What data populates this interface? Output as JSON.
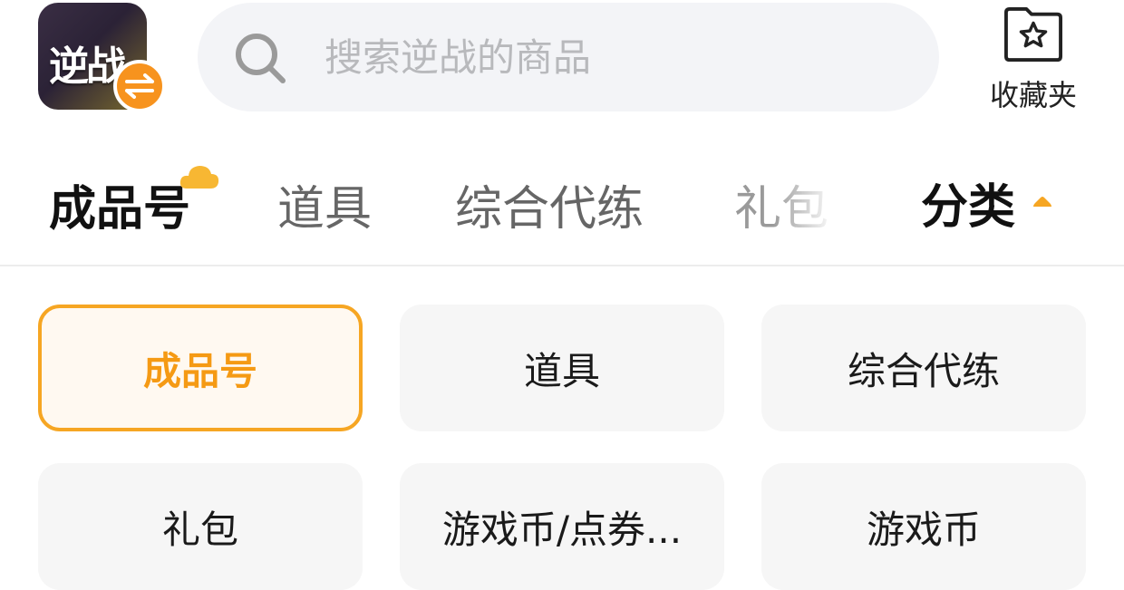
{
  "header": {
    "game_icon_text": "逆战",
    "search_placeholder": "搜索逆战的商品",
    "favorites_label": "收藏夹"
  },
  "tabs": [
    {
      "label": "成品号",
      "active": true
    },
    {
      "label": "道具",
      "active": false
    },
    {
      "label": "综合代练",
      "active": false
    },
    {
      "label": "礼包",
      "active": false
    }
  ],
  "category_toggle": {
    "label": "分类",
    "expanded": true
  },
  "categories": [
    {
      "label": "成品号",
      "selected": true
    },
    {
      "label": "道具",
      "selected": false
    },
    {
      "label": "综合代练",
      "selected": false
    },
    {
      "label": "礼包",
      "selected": false
    },
    {
      "label": "游戏币/点券...",
      "selected": false
    },
    {
      "label": "游戏币",
      "selected": false
    }
  ],
  "colors": {
    "accent": "#f6a623",
    "accent_text": "#f59a14",
    "chip_bg": "#f6f6f6",
    "search_bg": "#f3f4f7"
  },
  "icons": [
    "search-icon",
    "star-folder-icon",
    "switch-arrows-icon",
    "cloud-icon",
    "caret-up-icon"
  ]
}
